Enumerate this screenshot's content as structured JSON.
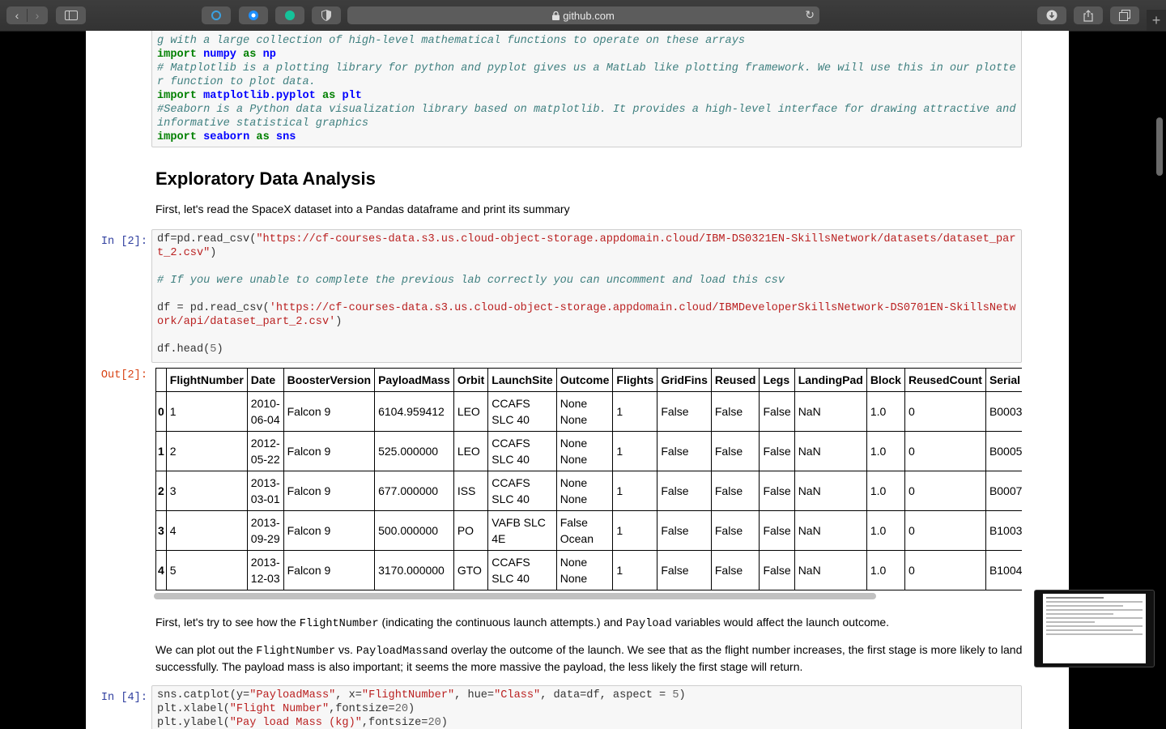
{
  "browser": {
    "url": "github.com",
    "back_icon": "‹",
    "forward_icon": "›",
    "reload_icon": "↻",
    "new_tab_icon": "+"
  },
  "notebook": {
    "imports_cell": {
      "comment_numpy_tail": "g with a large collection of high-level mathematical functions to operate on these arrays",
      "import_numpy": [
        "import",
        "numpy",
        "as",
        "np"
      ],
      "comment_matplotlib": "# Matplotlib is a plotting library for python and pyplot gives us a MatLab like plotting framework. We will use this in our plotter function to plot data.",
      "import_matplotlib": [
        "import",
        "matplotlib.pyplot",
        "as",
        "plt"
      ],
      "comment_seaborn": "#Seaborn is a Python data visualization library based on matplotlib. It provides a high-level interface for drawing attractive and informative statistical graphics",
      "import_seaborn": [
        "import",
        "seaborn",
        "as",
        "sns"
      ]
    },
    "heading": "Exploratory Data Analysis",
    "intro_text": "First, let's read the SpaceX dataset into a Pandas dataframe and print its summary",
    "cell2": {
      "prompt": "In [2]:",
      "line1_pre": "df=pd.read_csv(",
      "line1_str": "\"https://cf-courses-data.s3.us.cloud-object-storage.appdomain.cloud/IBM-DS0321EN-SkillsNetwork/datasets/dataset_part_2.csv\"",
      "line1_post": ")",
      "comment": "# If you were unable to complete the previous lab correctly you can uncomment and load this csv",
      "line2_pre": "df = pd.read_csv(",
      "line2_str": "'https://cf-courses-data.s3.us.cloud-object-storage.appdomain.cloud/IBMDeveloperSkillsNetwork-DS0701EN-SkillsNetwork/api/dataset_part_2.csv'",
      "line2_post": ")",
      "line3_pre": "df.head(",
      "line3_num": "5",
      "line3_post": ")"
    },
    "out2": {
      "prompt": "Out[2]:",
      "columns": [
        "",
        "FlightNumber",
        "Date",
        "BoosterVersion",
        "PayloadMass",
        "Orbit",
        "LaunchSite",
        "Outcome",
        "Flights",
        "GridFins",
        "Reused",
        "Legs",
        "LandingPad",
        "Block",
        "ReusedCount",
        "Serial"
      ],
      "rows": [
        [
          "0",
          "1",
          "2010-06-04",
          "Falcon 9",
          "6104.959412",
          "LEO",
          "CCAFS SLC 40",
          "None None",
          "1",
          "False",
          "False",
          "False",
          "NaN",
          "1.0",
          "0",
          "B0003"
        ],
        [
          "1",
          "2",
          "2012-05-22",
          "Falcon 9",
          "525.000000",
          "LEO",
          "CCAFS SLC 40",
          "None None",
          "1",
          "False",
          "False",
          "False",
          "NaN",
          "1.0",
          "0",
          "B0005"
        ],
        [
          "2",
          "3",
          "2013-03-01",
          "Falcon 9",
          "677.000000",
          "ISS",
          "CCAFS SLC 40",
          "None None",
          "1",
          "False",
          "False",
          "False",
          "NaN",
          "1.0",
          "0",
          "B0007"
        ],
        [
          "3",
          "4",
          "2013-09-29",
          "Falcon 9",
          "500.000000",
          "PO",
          "VAFB SLC 4E",
          "False Ocean",
          "1",
          "False",
          "False",
          "False",
          "NaN",
          "1.0",
          "0",
          "B1003"
        ],
        [
          "4",
          "5",
          "2013-12-03",
          "Falcon 9",
          "3170.000000",
          "GTO",
          "CCAFS SLC 40",
          "None None",
          "1",
          "False",
          "False",
          "False",
          "NaN",
          "1.0",
          "0",
          "B1004"
        ]
      ]
    },
    "para1": [
      "First, let's try to see how the ",
      "FlightNumber",
      " (indicating the continuous launch attempts.) and ",
      "Payload",
      " variables would affect the launch outcome."
    ],
    "para2": [
      "We can plot out the ",
      "FlightNumber",
      " vs. ",
      "PayloadMass",
      "and overlay the outcome of the launch. We see that as the flight number increases, the first stage is more likely to land successfully. The payload mass is also important; it seems the more massive the payload, the less likely the first stage will return."
    ],
    "cell4": {
      "prompt": "In [4]:",
      "l1": [
        "sns.catplot(y=",
        "\"PayloadMass\"",
        ", x=",
        "\"FlightNumber\"",
        ", hue=",
        "\"Class\"",
        ", data=df, aspect = ",
        "5",
        ")"
      ],
      "l2": [
        "plt.xlabel(",
        "\"Flight Number\"",
        ",fontsize=",
        "20",
        ")"
      ],
      "l3": [
        "plt.ylabel(",
        "\"Pay load Mass (kg)\"",
        ",fontsize=",
        "20",
        ")"
      ]
    }
  }
}
